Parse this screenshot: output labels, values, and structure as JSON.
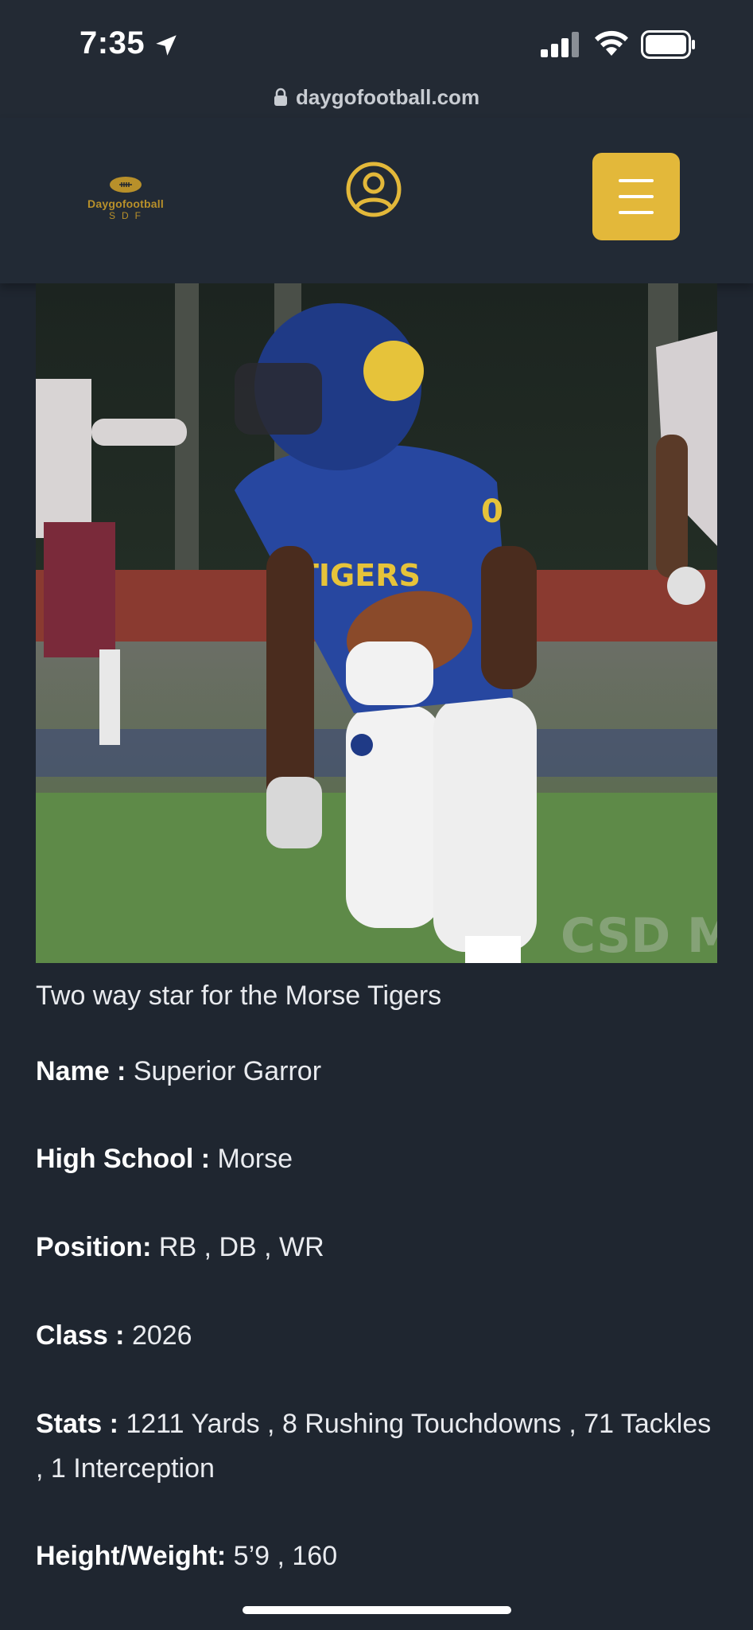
{
  "status_bar": {
    "time": "7:35",
    "url": "daygofootball.com"
  },
  "header": {
    "logo_text": "Daygofootball",
    "logo_sub": "SDF",
    "accent_color": "#e3b83a"
  },
  "hero": {
    "watermark": "CSD M"
  },
  "caption": "Two way star for the Morse Tigers",
  "profile": {
    "name_label": "Name :",
    "name_value": " Superior Garror",
    "school_label": "High School :",
    "school_value": " Morse",
    "position_label": "Position:",
    "position_value": " RB , DB , WR",
    "class_label": "Class :",
    "class_value": " 2026",
    "stats_label": "Stats :",
    "stats_value": " 1211 Yards , 8 Rushing Touchdowns , 71 Tackles , 1 Interception",
    "hw_label": "Height/Weight:",
    "hw_value": " 5’9 , 160"
  },
  "icons": {
    "location": "location-arrow-icon",
    "signal": "signal-icon",
    "wifi": "wifi-icon",
    "battery": "battery-icon",
    "lock": "lock-icon",
    "account": "user-circle-icon",
    "menu": "hamburger-menu-icon"
  }
}
